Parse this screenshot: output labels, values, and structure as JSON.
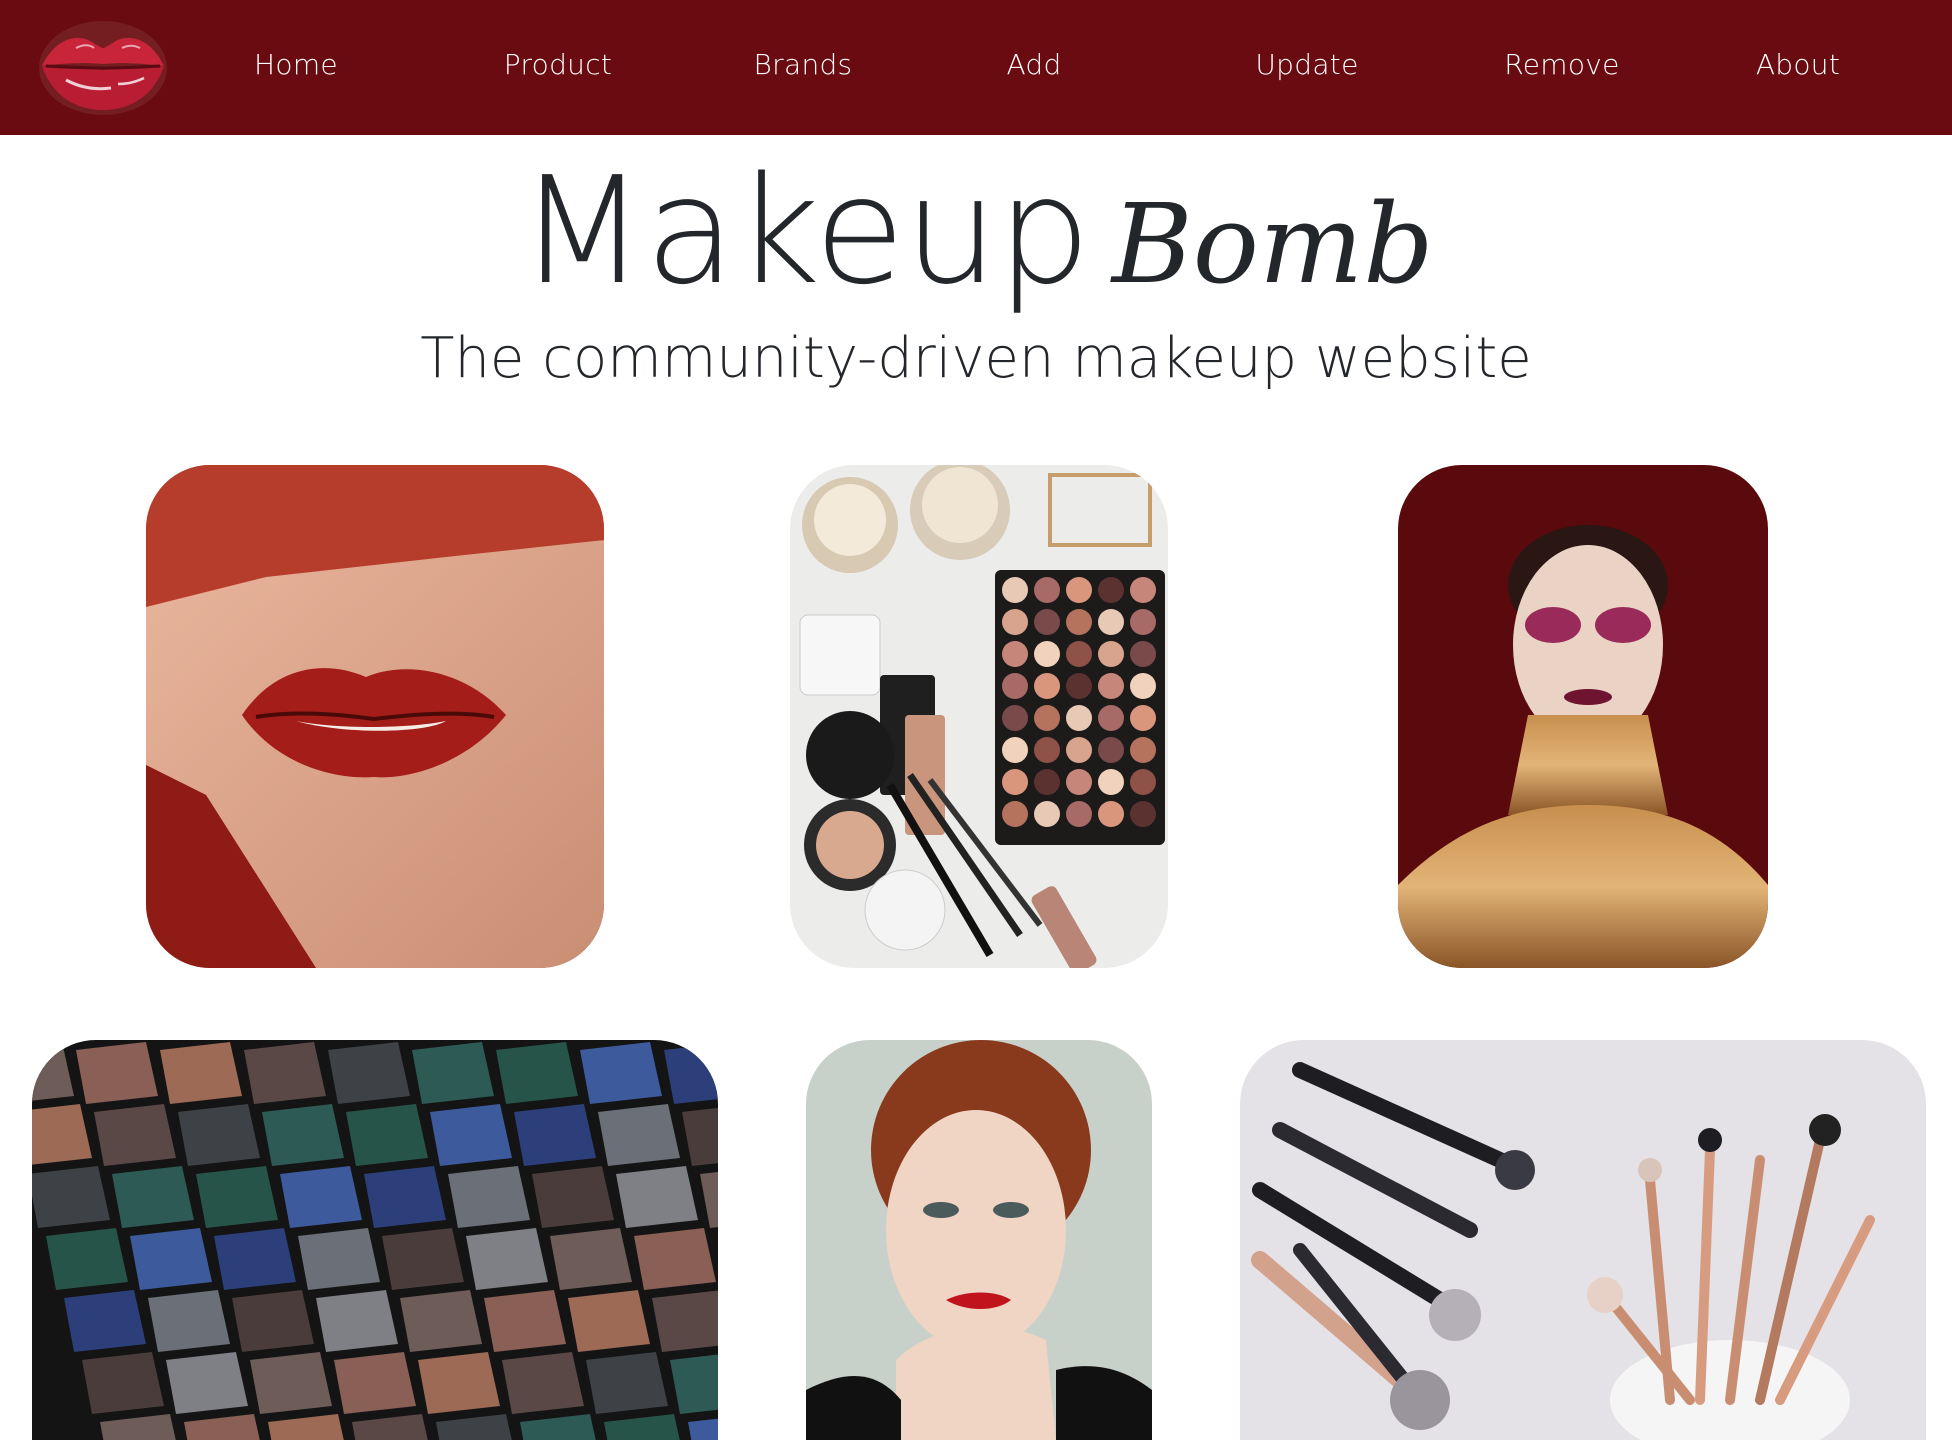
{
  "app": {
    "brand_colors": {
      "nav_bg": "#690b10",
      "text": "#23262a",
      "nav_text": "#ffffff"
    }
  },
  "nav": {
    "logo_icon": "lips-kiss-icon",
    "links": [
      {
        "label": "Home"
      },
      {
        "label": "Product"
      },
      {
        "label": "Brands"
      },
      {
        "label": "Add"
      },
      {
        "label": "Update"
      },
      {
        "label": "Remove"
      },
      {
        "label": "About"
      }
    ]
  },
  "hero": {
    "title_main": "Makeup",
    "title_script": "Bomb",
    "subtitle": "The community-driven makeup website"
  },
  "gallery": {
    "photos": [
      {
        "subject": "red lips torn paper"
      },
      {
        "subject": "makeup flatlay palette"
      },
      {
        "subject": "model gold body paint"
      },
      {
        "subject": "eyeshadow palette closeup"
      },
      {
        "subject": "red hair woman portrait"
      },
      {
        "subject": "makeup brushes cup"
      }
    ]
  }
}
